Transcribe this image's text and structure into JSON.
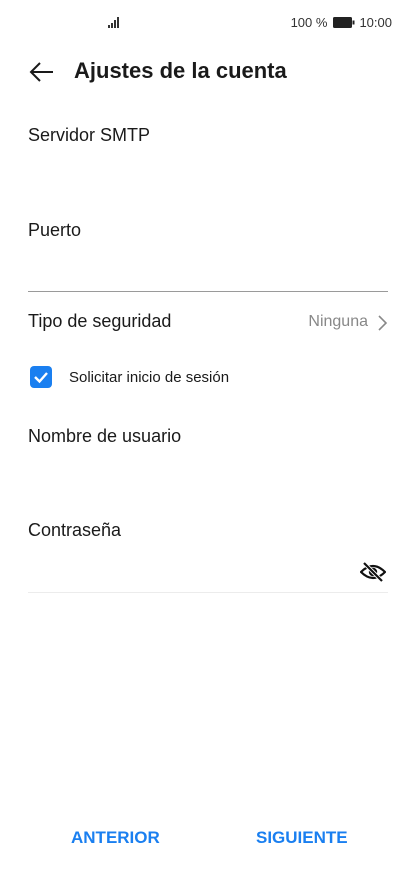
{
  "status_bar": {
    "battery": "100 %",
    "time": "10:00",
    "icons": [
      "signal-icon",
      "battery-icon"
    ]
  },
  "header": {
    "title": "Ajustes de la cuenta",
    "back_icon": "arrow-left-icon"
  },
  "fields": {
    "smtp_server": {
      "label": "Servidor SMTP",
      "value": ""
    },
    "port": {
      "label": "Puerto",
      "value": ""
    },
    "username": {
      "label": "Nombre de usuario",
      "value": ""
    },
    "password": {
      "label": "Contraseña",
      "value": "",
      "toggle_icon": "eye-off-icon"
    }
  },
  "security": {
    "label": "Tipo de seguridad",
    "value": "Ninguna"
  },
  "login_checkbox": {
    "label": "Solicitar inicio de sesión",
    "checked": true
  },
  "footer": {
    "previous_label": "ANTERIOR",
    "next_label": "SIGUIENTE"
  },
  "colors": {
    "accent": "#1a7ff0",
    "text": "#1a1a1a",
    "secondary": "#888888",
    "divider": "#cccccc"
  }
}
